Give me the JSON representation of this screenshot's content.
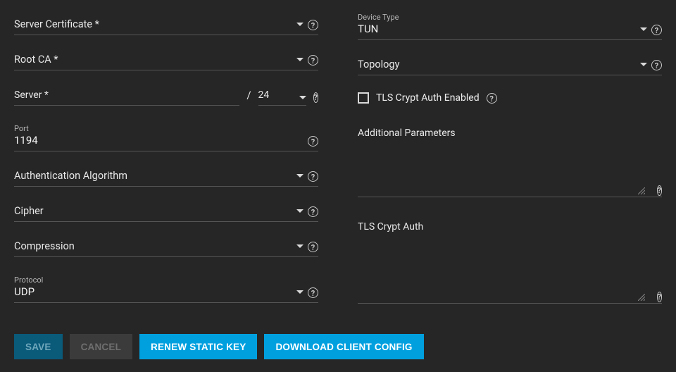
{
  "left": {
    "server_certificate": {
      "label": "Server Certificate *"
    },
    "root_ca": {
      "label": "Root CA *"
    },
    "server": {
      "label": "Server *",
      "cidr": "24"
    },
    "port": {
      "floating": "Port",
      "value": "1194"
    },
    "auth_algo": {
      "label": "Authentication Algorithm"
    },
    "cipher": {
      "label": "Cipher"
    },
    "compression": {
      "label": "Compression"
    },
    "protocol": {
      "floating": "Protocol",
      "value": "UDP"
    }
  },
  "right": {
    "device_type": {
      "floating": "Device Type",
      "value": "TUN"
    },
    "topology": {
      "label": "Topology"
    },
    "tls_crypt_checkbox": {
      "label": "TLS Crypt Auth Enabled"
    },
    "additional_params": {
      "label": "Additional Parameters"
    },
    "tls_crypt_auth": {
      "label": "TLS Crypt Auth"
    }
  },
  "buttons": {
    "save": "SAVE",
    "cancel": "CANCEL",
    "renew": "RENEW STATIC KEY",
    "download": "DOWNLOAD CLIENT CONFIG"
  },
  "divider": "/"
}
